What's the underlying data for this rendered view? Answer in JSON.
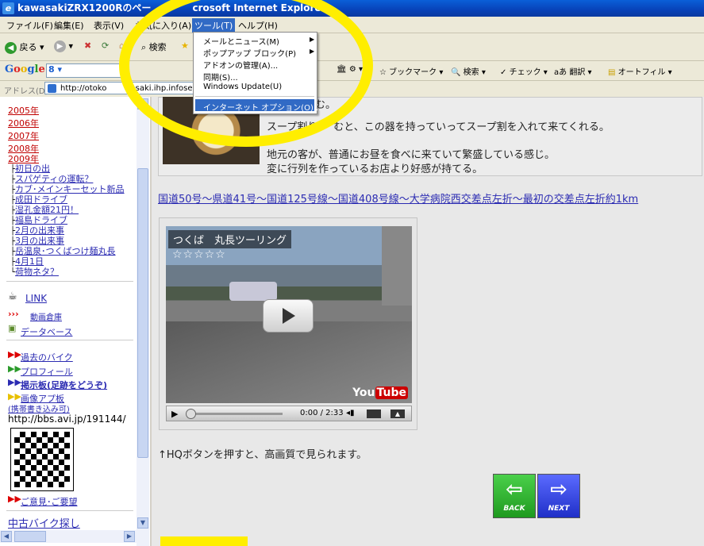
{
  "window": {
    "title_prefix": "kawasakiZRX1200Rのペー",
    "title_suffix": "crosoft Internet Explorer"
  },
  "menubar": {
    "items": [
      "ファイル(F)",
      "編集(E)",
      "表示(V)",
      "お気に入り(A)",
      "ツール(T)",
      "ヘルプ(H)"
    ]
  },
  "toolbar": {
    "back": "戻る",
    "search": "検索"
  },
  "google_bar": {
    "logo": "Google",
    "items": [
      "ブックマーク",
      "検索",
      "チェック",
      "翻訳",
      "オートフィル"
    ]
  },
  "address": {
    "label": "アドレス(D)",
    "url_prefix": "http://otoko",
    "url_suffix": "wasaki.ihp.infoseek.c"
  },
  "tools_menu": {
    "items": [
      "メールとニュース(M)",
      "ポップアップ ブロック(P)",
      "アドオンの管理(A)...",
      "同期(S)...",
      "Windows Update(U)",
      "インターネット オプション(O)..."
    ],
    "highlighted": "インターネット オプション(O)..."
  },
  "sidebar": {
    "years": [
      "2005年",
      "2006年",
      "2007年",
      "2008年",
      "2009年"
    ],
    "posts": [
      "初日の出",
      "スパゲティの運転？",
      "カブ･メインキーセット新品",
      "成田ドライブ",
      "湿孔金額21円！",
      "福島ドライブ",
      "2月の出来事",
      "3月の出来事",
      "岳温泉･つくばつけ麺丸長",
      "4月1日",
      "荷物ネタ？"
    ],
    "link_header": "LINK",
    "link_items": [
      "動画倉庫",
      "データベース"
    ],
    "section_items": [
      "過去のバイク",
      "プロフィール",
      "掲示板(足跡をどうぞ)",
      "画像アプ板",
      "(携帯書き込み可)"
    ],
    "bbs_url": "http://bbs.avi.jp/191144/",
    "request": "ご意見･ご要望",
    "used_bike": "中古バイク探し"
  },
  "main": {
    "text_top": "む。",
    "text1": "スープ割り",
    "text1_end": "むと、この器を持っていってスープ割を入れて来てくれる。",
    "text2": "地元の客が、普通にお昼を食べに来ていて繁盛している感じ。",
    "text3": "変に行列を作っているお店より好感が持てる。",
    "route": "国道50号～県道41号～国道125号線～国道408号線～大学病院西交差点左折～最初の交差点左折約1km",
    "hq_note": "↑HQボタンを押すと、高画質で見られます。"
  },
  "video": {
    "title": "つくば　丸長ツーリング",
    "stars": "☆☆☆☆☆",
    "time": "0:00 / 2:33",
    "logo_you": "You",
    "logo_tube": "Tube"
  },
  "nav": {
    "back": "BACK",
    "next": "NEXT"
  }
}
